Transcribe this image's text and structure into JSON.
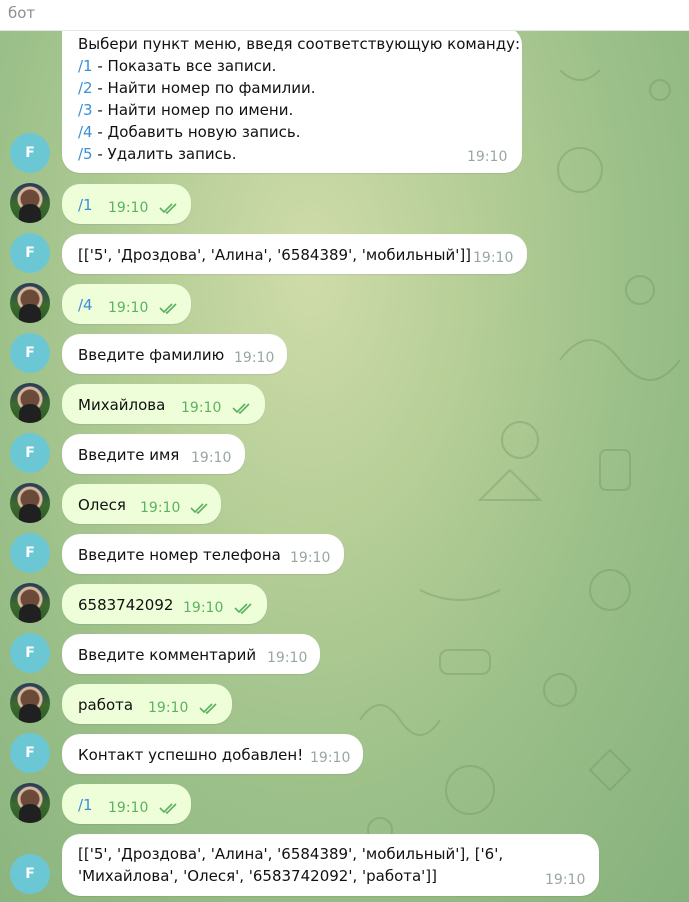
{
  "header": {
    "title": "бот"
  },
  "avatar_initial": "F",
  "messages": {
    "m0": {
      "lines": [
        "Выбери пункт меню, введя соответствующую команду:",
        "/1 - Показать все записи.",
        "/2 - Найти номер по фамилии.",
        "/3 - Найти номер по имени.",
        "/4 - Добавить новую запись.",
        "/5 - Удалить запись."
      ],
      "time": "19:10"
    },
    "m1": {
      "text": "/1",
      "time": "19:10"
    },
    "m2": {
      "text": "[['5', 'Дроздова', 'Алина', '6584389', 'мобильный']]",
      "time": "19:10"
    },
    "m3": {
      "text": "/4",
      "time": "19:10"
    },
    "m4": {
      "text": "Введите фамилию",
      "time": "19:10"
    },
    "m5": {
      "text": "Михайлова",
      "time": "19:10"
    },
    "m6": {
      "text": "Введите имя",
      "time": "19:10"
    },
    "m7": {
      "text": "Олеся",
      "time": "19:10"
    },
    "m8": {
      "text": "Введите номер телефона",
      "time": "19:10"
    },
    "m9": {
      "text": "6583742092",
      "time": "19:10"
    },
    "m10": {
      "text": "Введите комментарий",
      "time": "19:10"
    },
    "m11": {
      "text": "работа",
      "time": "19:10"
    },
    "m12": {
      "text": "Контакт успешно добавлен!",
      "time": "19:10"
    },
    "m13": {
      "text": "/1",
      "time": "19:10"
    },
    "m14": {
      "lines": [
        "[['5', 'Дроздова', 'Алина', '6584389', 'мобильный'], ['6',",
        "'Михайлова', 'Олеся', '6583742092', 'работа']]"
      ],
      "time": "19:10"
    }
  },
  "menu_commands": [
    "/1",
    "/2",
    "/3",
    "/4",
    "/5"
  ],
  "menu_descriptions": [
    " - Показать все записи.",
    " - Найти номер по фамилии.",
    " - Найти номер по имени.",
    " - Добавить новую запись.",
    " - Удалить запись."
  ],
  "colors": {
    "link": "#3a8fd6",
    "outgoing_bubble": "#eefed9",
    "check": "#5bb260",
    "bot_avatar": "#6cc7d4"
  }
}
